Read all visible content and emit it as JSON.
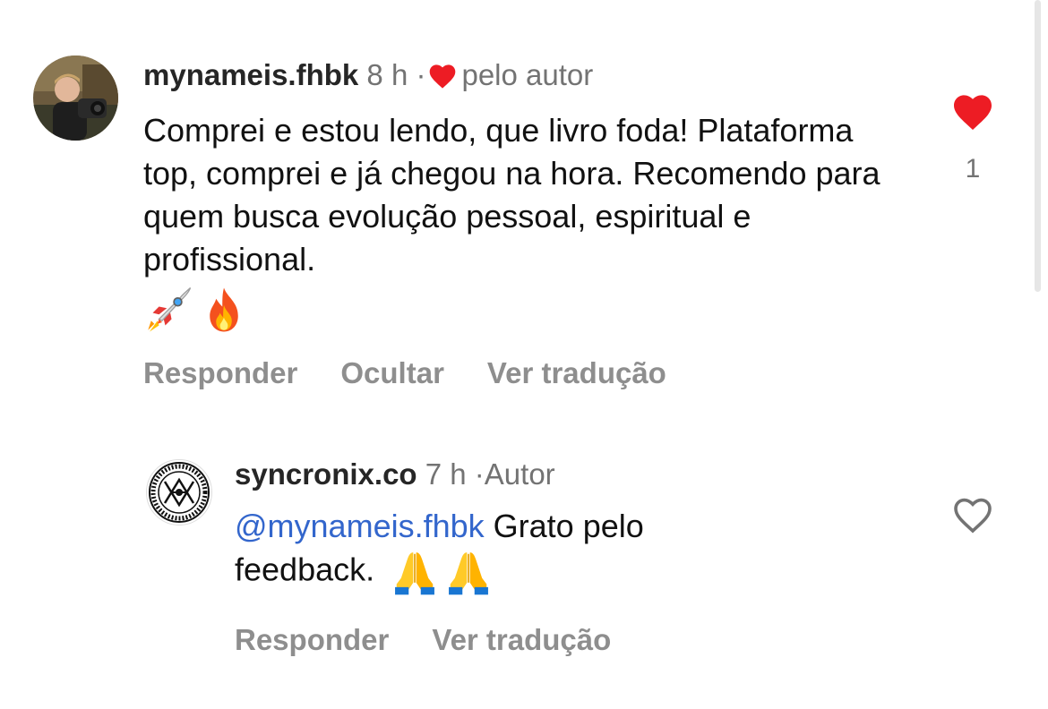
{
  "comments": [
    {
      "username": "mynameis.fhbk",
      "time": "8 h",
      "separator": "·",
      "liked_by_author_label": "pelo autor",
      "text": "Comprei e estou lendo, que livro foda! Plataforma top, comprei e já chegou na hora. Recomendo para quem busca evolução pessoal, espiritual e profissional.",
      "emojis": [
        "rocket-emoji",
        "fire-emoji"
      ],
      "actions": {
        "reply": "Responder",
        "hide": "Ocultar",
        "translate": "Ver tradução"
      },
      "like": {
        "liked": true,
        "count": "1",
        "color": "#ed1c24"
      }
    },
    {
      "username": "syncronix.co",
      "time": "7 h",
      "separator": "·",
      "author_label": "Autor",
      "mention": "@mynameis.fhbk",
      "text": "Grato pelo feedback.",
      "emojis": [
        "folded-hands-emoji",
        "folded-hands-emoji"
      ],
      "actions": {
        "reply": "Responder",
        "translate": "Ver tradução"
      },
      "like": {
        "liked": false,
        "count": ""
      }
    }
  ]
}
